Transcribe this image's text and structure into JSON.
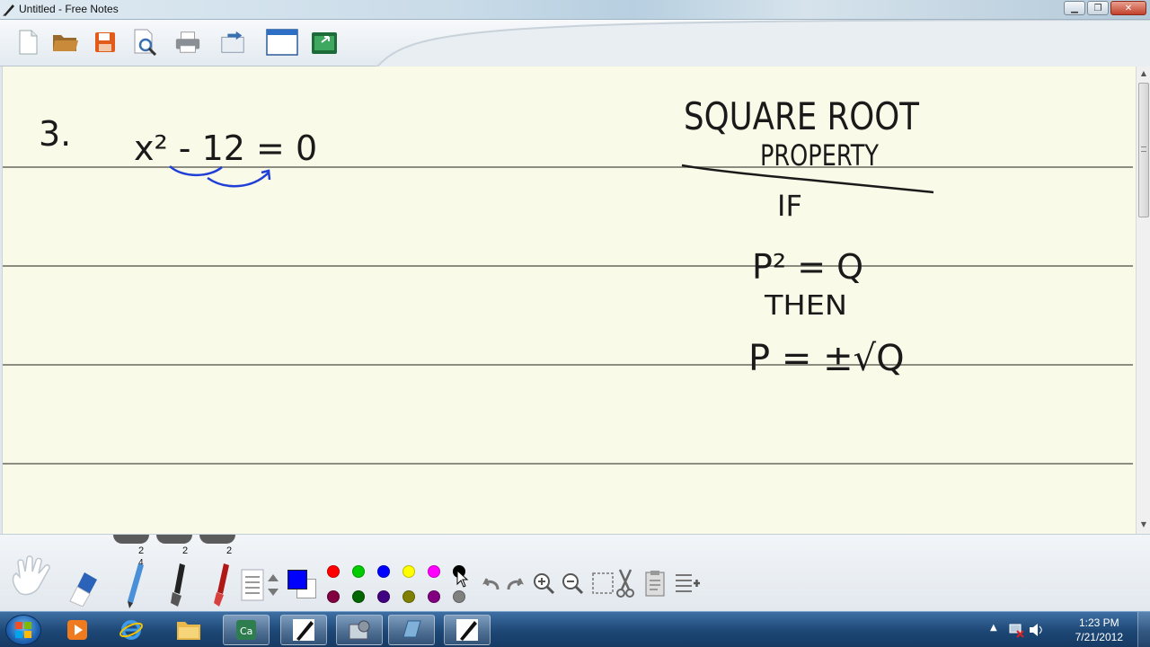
{
  "window": {
    "title": "Untitled - Free Notes",
    "controls": [
      "minimize",
      "maximize",
      "close"
    ]
  },
  "toolbar": {
    "buttons": [
      {
        "name": "new-document",
        "icon": "new-page-icon"
      },
      {
        "name": "open",
        "icon": "folder-icon"
      },
      {
        "name": "save",
        "icon": "floppy-disk-icon"
      },
      {
        "name": "print-preview",
        "icon": "magnifier-page-icon"
      },
      {
        "name": "print",
        "icon": "printer-icon"
      },
      {
        "name": "export",
        "icon": "export-icon"
      },
      {
        "name": "window-mode",
        "icon": "window-icon"
      },
      {
        "name": "screen-capture",
        "icon": "green-screen-icon"
      }
    ]
  },
  "notes": {
    "problem_number": "3.",
    "equation": "x² - 12 = 0",
    "heading_line1": "SQUARE ROOT",
    "heading_line2": "PROPERTY",
    "if_label": "IF",
    "condition": "P² = Q",
    "then_label": "THEN",
    "conclusion": "P = ±√Q",
    "ink_colors": {
      "black": "#1a1a1a",
      "blue": "#1f3fd6"
    }
  },
  "palette": {
    "pen_widths": [
      "2",
      "2",
      "2"
    ],
    "pencil_width_marker": "4",
    "current_color": "#0000ff",
    "swatches_top": [
      "#ff0000",
      "#00cc00",
      "#0000ff",
      "#ffff00",
      "#ff00ff",
      "#000000"
    ],
    "swatches_bottom": [
      "#800040",
      "#006600",
      "#400080",
      "#808000",
      "#800080",
      "#808080"
    ]
  },
  "taskbar": {
    "time": "1:23 PM",
    "date": "7/21/2012"
  }
}
